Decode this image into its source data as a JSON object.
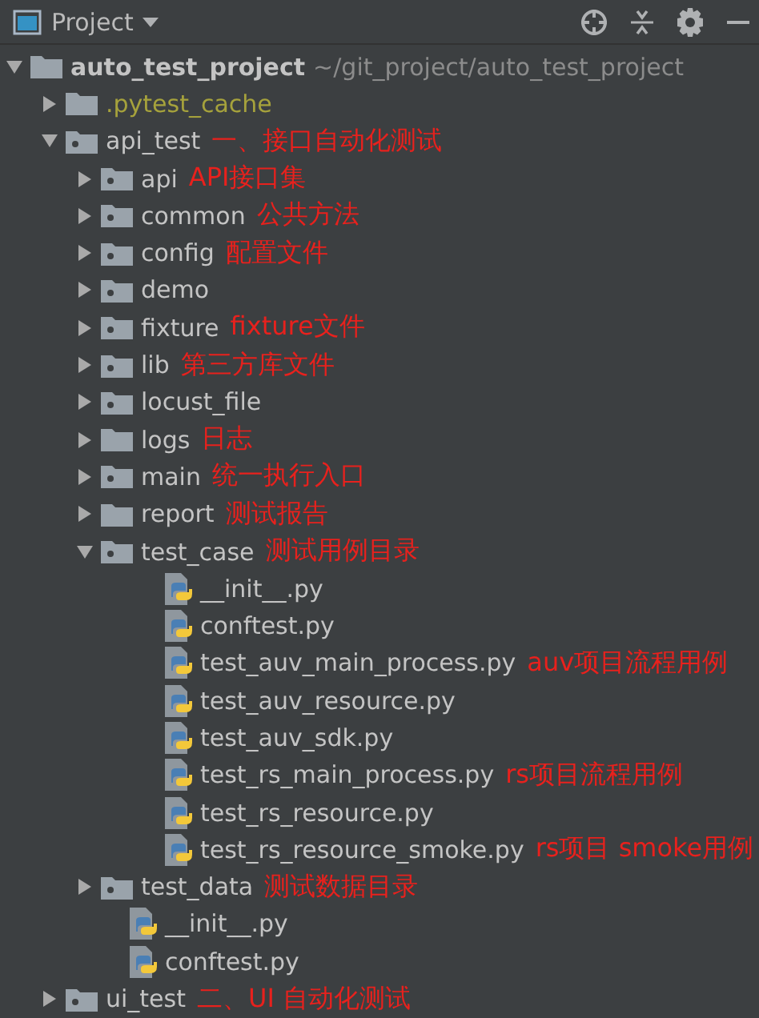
{
  "header": {
    "title": "Project"
  },
  "tree": [
    {
      "kind": "folder",
      "name": "auto_test_project",
      "path": "~/git_project/auto_test_project",
      "expanded": true,
      "children": [
        {
          "kind": "folder",
          "name": ".pytest_cache",
          "excluded": true,
          "expanded": false
        },
        {
          "kind": "package",
          "name": "api_test",
          "note": "一、接口自动化测试",
          "expanded": true,
          "children": [
            {
              "kind": "package",
              "name": "api",
              "note": "API接口集",
              "expanded": false
            },
            {
              "kind": "package",
              "name": "common",
              "note": "公共方法",
              "expanded": false
            },
            {
              "kind": "package",
              "name": "config",
              "note": "配置文件",
              "expanded": false
            },
            {
              "kind": "package",
              "name": "demo",
              "expanded": false
            },
            {
              "kind": "package",
              "name": "fixture",
              "note": "fixture文件",
              "expanded": false
            },
            {
              "kind": "package",
              "name": "lib",
              "note": "第三方库文件",
              "expanded": false
            },
            {
              "kind": "package",
              "name": "locust_file",
              "expanded": false
            },
            {
              "kind": "folder",
              "name": "logs",
              "note": "日志",
              "expanded": false
            },
            {
              "kind": "package",
              "name": "main",
              "note": "统一执行入口",
              "expanded": false
            },
            {
              "kind": "folder",
              "name": "report",
              "note": "测试报告",
              "expanded": false
            },
            {
              "kind": "package",
              "name": "test_case",
              "note": "测试用例目录",
              "expanded": true,
              "children": [
                {
                  "kind": "file",
                  "name": "__init__.py"
                },
                {
                  "kind": "file",
                  "name": "conftest.py"
                },
                {
                  "kind": "file",
                  "name": "test_auv_main_process.py",
                  "note": "auv项目流程用例"
                },
                {
                  "kind": "file",
                  "name": "test_auv_resource.py"
                },
                {
                  "kind": "file",
                  "name": "test_auv_sdk.py"
                },
                {
                  "kind": "file",
                  "name": "test_rs_main_process.py",
                  "note": "rs项目流程用例"
                },
                {
                  "kind": "file",
                  "name": "test_rs_resource.py"
                },
                {
                  "kind": "file",
                  "name": "test_rs_resource_smoke.py",
                  "note": "rs项目 smoke用例"
                }
              ]
            },
            {
              "kind": "package",
              "name": "test_data",
              "note": "测试数据目录",
              "expanded": false
            },
            {
              "kind": "file",
              "name": "__init__.py"
            },
            {
              "kind": "file",
              "name": "conftest.py"
            }
          ]
        },
        {
          "kind": "package",
          "name": "ui_test",
          "note": "二、UI 自动化测试",
          "expanded": false
        }
      ]
    }
  ]
}
